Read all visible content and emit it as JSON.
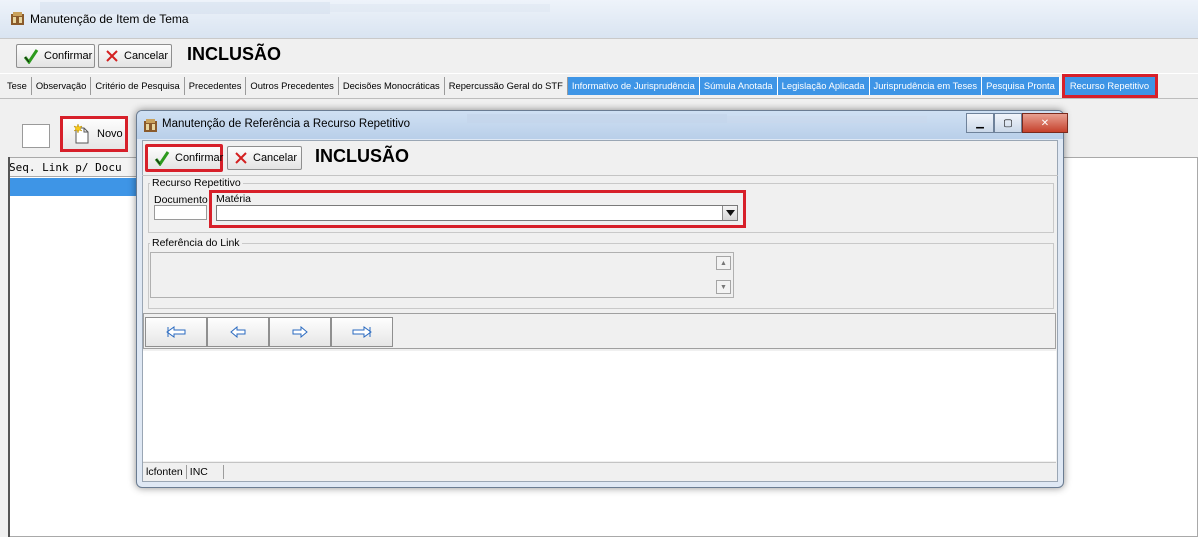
{
  "main": {
    "title": "Manutenção de Item de Tema",
    "toolbar": {
      "confirm_label": "Confirmar",
      "cancel_label": "Cancelar",
      "mode": "INCLUSÃO"
    },
    "tabs": [
      {
        "label": "Tese",
        "style": "plain"
      },
      {
        "label": "Observação",
        "style": "plain"
      },
      {
        "label": "Critério de Pesquisa",
        "style": "plain"
      },
      {
        "label": "Precedentes",
        "style": "plain"
      },
      {
        "label": "Outros Precedentes",
        "style": "plain"
      },
      {
        "label": "Decisões Monocráticas",
        "style": "plain"
      },
      {
        "label": "Repercussão Geral do STF",
        "style": "plain"
      },
      {
        "label": "Informativo de Jurisprudência",
        "style": "blue"
      },
      {
        "label": "Súmula Anotada",
        "style": "blue"
      },
      {
        "label": "Legislação Aplicada",
        "style": "blue"
      },
      {
        "label": "Jurisprudência em Teses",
        "style": "blue"
      },
      {
        "label": "Pesquisa Pronta",
        "style": "blue"
      },
      {
        "label": "Recurso Repetitivo",
        "style": "active"
      }
    ],
    "subtoolbar": {
      "novo_label": "Novo"
    },
    "grid": {
      "header": "Seq. Link p/ Docu"
    }
  },
  "dialog": {
    "title": "Manutenção de Referência a Recurso Repetitivo",
    "toolbar": {
      "confirm_label": "Confirmar",
      "cancel_label": "Cancelar",
      "mode": "INCLUSÃO"
    },
    "group_recurso": {
      "label": "Recurso Repetitivo",
      "documento_label": "Documento",
      "documento_value": "",
      "materia_label": "Matéria",
      "materia_value": ""
    },
    "group_referencia": {
      "label": "Referência do Link",
      "value": ""
    },
    "nav_buttons": [
      "first-arrow",
      "prev-arrow",
      "next-arrow",
      "last-arrow"
    ],
    "status": {
      "user": "lcfonten",
      "mode": "INC"
    }
  },
  "colors": {
    "highlight_red": "#d7202a",
    "tab_blue": "#3e95e6",
    "selection_blue": "#3e95e6"
  }
}
